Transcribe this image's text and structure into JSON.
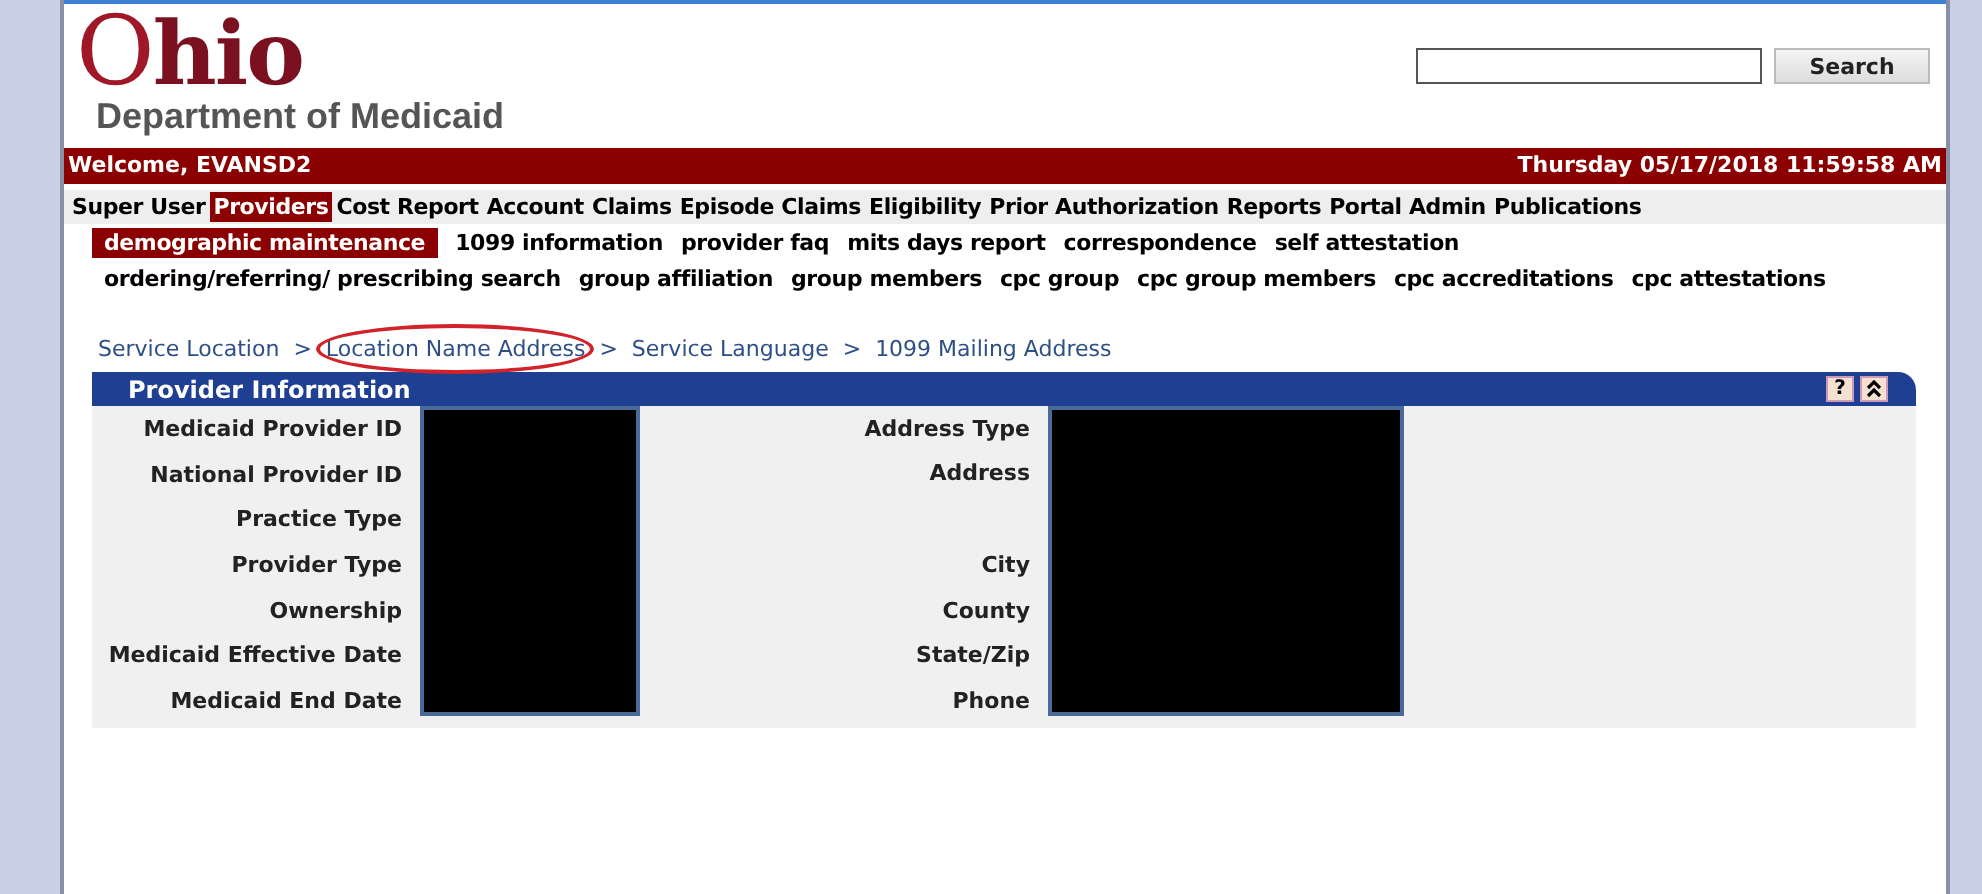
{
  "logo": {
    "title": "Ohio",
    "subtitle": "Department of Medicaid"
  },
  "search": {
    "button": "Search"
  },
  "status_bar": {
    "welcome": "Welcome, EVANSD2",
    "datetime": "Thursday 05/17/2018 11:59:58 AM"
  },
  "menu": [
    {
      "label": "Super User",
      "selected": false
    },
    {
      "label": "Providers",
      "selected": true
    },
    {
      "label": "Cost Report",
      "selected": false
    },
    {
      "label": "Account",
      "selected": false
    },
    {
      "label": "Claims",
      "selected": false
    },
    {
      "label": "Episode Claims",
      "selected": false
    },
    {
      "label": "Eligibility",
      "selected": false
    },
    {
      "label": "Prior Authorization",
      "selected": false
    },
    {
      "label": "Reports",
      "selected": false
    },
    {
      "label": "Portal Admin",
      "selected": false
    },
    {
      "label": "Publications",
      "selected": false
    }
  ],
  "submenu_rows": [
    [
      {
        "label": "demographic maintenance",
        "selected": true
      },
      {
        "label": "1099 information",
        "selected": false
      },
      {
        "label": "provider faq",
        "selected": false
      },
      {
        "label": "mits days report",
        "selected": false
      },
      {
        "label": "correspondence",
        "selected": false
      },
      {
        "label": "self attestation",
        "selected": false
      }
    ],
    [
      {
        "label": "ordering/referring/ prescribing search",
        "selected": false
      },
      {
        "label": "group affiliation",
        "selected": false
      },
      {
        "label": "group members",
        "selected": false
      },
      {
        "label": "cpc group",
        "selected": false
      },
      {
        "label": "cpc group members",
        "selected": false
      },
      {
        "label": "cpc accreditations",
        "selected": false
      },
      {
        "label": "cpc attestations",
        "selected": false
      }
    ]
  ],
  "breadcrumb": [
    {
      "label": "Service Location",
      "circled": false
    },
    {
      "label": "Location Name Address",
      "circled": true
    },
    {
      "label": "Service Language",
      "circled": false
    },
    {
      "label": "1099 Mailing Address",
      "circled": false
    }
  ],
  "breadcrumb_separator": ">",
  "panel": {
    "title": "Provider Information",
    "help": "?",
    "left_fields": [
      {
        "label": "Medicaid Provider ID",
        "kind": "single"
      },
      {
        "label": "National Provider ID",
        "kind": "single"
      },
      {
        "label": "Practice Type",
        "kind": "single"
      },
      {
        "label": "Provider Type",
        "kind": "single"
      },
      {
        "label": "Ownership",
        "kind": "single"
      },
      {
        "label": "Medicaid Effective Date",
        "kind": "single"
      },
      {
        "label": "Medicaid End Date",
        "kind": "single"
      }
    ],
    "right_fields": [
      {
        "label": "Address Type",
        "kind": "single"
      },
      {
        "label": "Address",
        "kind": "multiline"
      },
      {
        "label": "City",
        "kind": "single"
      },
      {
        "label": "County",
        "kind": "single"
      },
      {
        "label": "State/Zip",
        "kind": "single"
      },
      {
        "label": "Phone",
        "kind": "single"
      }
    ]
  }
}
